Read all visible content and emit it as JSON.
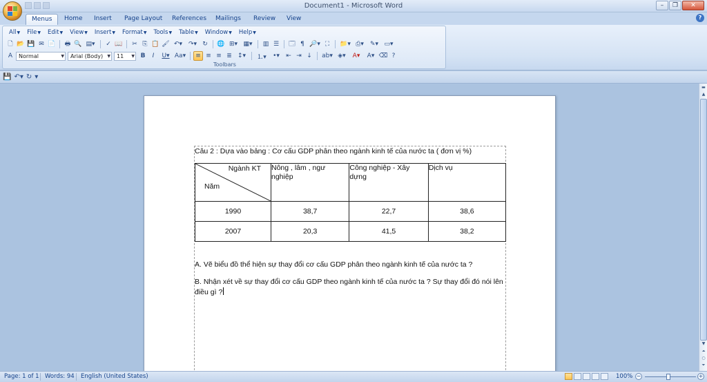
{
  "window": {
    "title": "Document1 - Microsoft Word",
    "minimize": "–",
    "maximize": "❐",
    "close": "✕"
  },
  "ribbon_tabs": [
    "Menus",
    "Home",
    "Insert",
    "Page Layout",
    "References",
    "Mailings",
    "Review",
    "View"
  ],
  "menus": [
    "All",
    "File",
    "Edit",
    "View",
    "Insert",
    "Format",
    "Tools",
    "Table",
    "Window",
    "Help"
  ],
  "toolbar": {
    "style": "Normal",
    "font": "Arial (Body)",
    "size": "11",
    "group_label": "Toolbars"
  },
  "document": {
    "heading": "Câu 2 : Dựa vào bảng : Cơ cấu GDP phân theo ngành kinh tế của nước ta ( đơn vị %)",
    "table": {
      "corner_top": "Ngành KT",
      "corner_bottom": "Năm",
      "headers": [
        "Nông , lâm , ngư nghiệp",
        "Công nghiệp - Xây dựng",
        "Dịch vụ"
      ],
      "rows": [
        {
          "year": "1990",
          "values": [
            "38,7",
            "22,7",
            "38,6"
          ]
        },
        {
          "year": "2007",
          "values": [
            "20,3",
            "41,5",
            "38,2"
          ]
        }
      ]
    },
    "para_a": "A. Vẽ biểu đồ thể hiện sự thay đổi cơ cấu GDP phân theo ngành kinh tế của nước ta ?",
    "para_b": "B. Nhận xét về sự thay đổi cơ cấu GDP theo ngành kinh tế của nước ta ? Sự thay đổi đó nói lên điều gì ?"
  },
  "status": {
    "page": "Page: 1 of 1",
    "words": "Words: 94",
    "language": "English (United States)",
    "zoom": "100%"
  }
}
